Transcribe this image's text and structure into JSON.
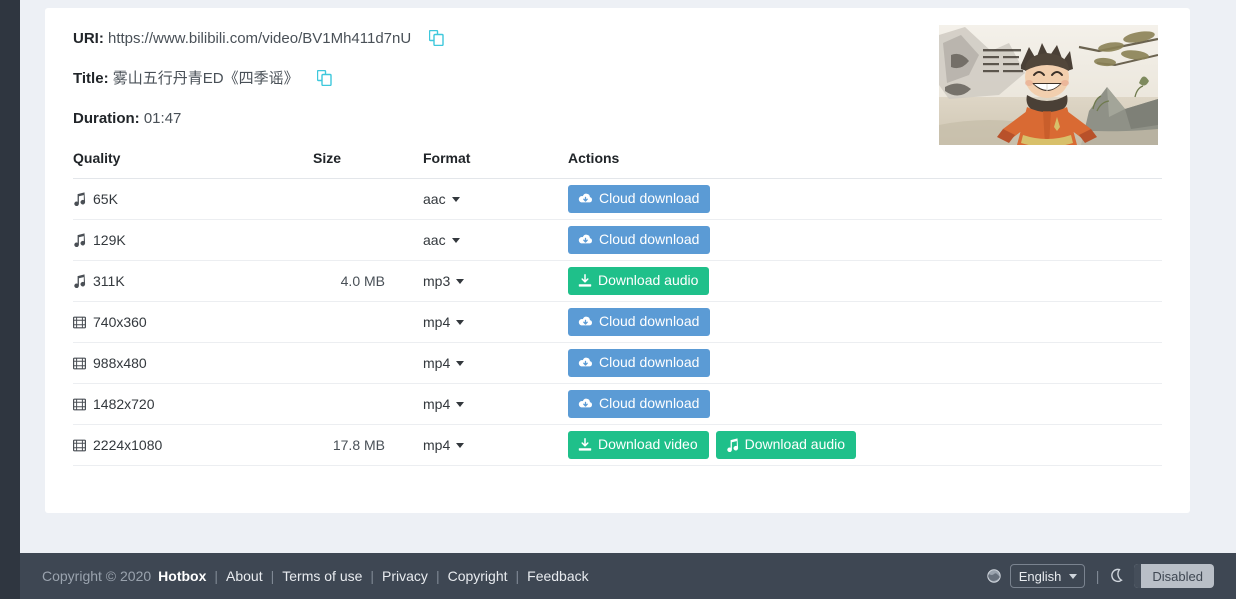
{
  "meta": {
    "uri_label": "URI:",
    "uri_value": "https://www.bilibili.com/video/BV1Mh411d7nU",
    "title_label": "Title:",
    "title_value": "雾山五行丹青ED《四季谣》",
    "duration_label": "Duration:",
    "duration_value": "01:47"
  },
  "icons": {
    "copy": "copy-icon",
    "audio": "music-note-icon",
    "video": "film-icon",
    "cloud": "cloud-download-icon",
    "download": "download-tray-icon",
    "globe": "globe-icon",
    "moon": "moon-icon"
  },
  "table": {
    "headers": [
      "Quality",
      "Size",
      "Format",
      "Actions"
    ],
    "rows": [
      {
        "kind": "audio",
        "quality": "65K",
        "size": "",
        "format": "aac",
        "actions": [
          {
            "label": "Cloud download",
            "style": "blue",
            "icon": "cloud-download-icon"
          }
        ]
      },
      {
        "kind": "audio",
        "quality": "129K",
        "size": "",
        "format": "aac",
        "actions": [
          {
            "label": "Cloud download",
            "style": "blue",
            "icon": "cloud-download-icon"
          }
        ]
      },
      {
        "kind": "audio",
        "quality": "311K",
        "size": "4.0 MB",
        "format": "mp3",
        "actions": [
          {
            "label": "Download audio",
            "style": "green",
            "icon": "download-tray-icon"
          }
        ]
      },
      {
        "kind": "video",
        "quality": "740x360",
        "size": "",
        "format": "mp4",
        "actions": [
          {
            "label": "Cloud download",
            "style": "blue",
            "icon": "cloud-download-icon"
          }
        ]
      },
      {
        "kind": "video",
        "quality": "988x480",
        "size": "",
        "format": "mp4",
        "actions": [
          {
            "label": "Cloud download",
            "style": "blue",
            "icon": "cloud-download-icon"
          }
        ]
      },
      {
        "kind": "video",
        "quality": "1482x720",
        "size": "",
        "format": "mp4",
        "actions": [
          {
            "label": "Cloud download",
            "style": "blue",
            "icon": "cloud-download-icon"
          }
        ]
      },
      {
        "kind": "video",
        "quality": "2224x1080",
        "size": "17.8 MB",
        "format": "mp4",
        "actions": [
          {
            "label": "Download video",
            "style": "green",
            "icon": "download-tray-icon"
          },
          {
            "label": "Download audio",
            "style": "green",
            "icon": "music-note-icon"
          }
        ]
      }
    ]
  },
  "footer": {
    "copyright": "Copyright © 2020",
    "brand": "Hotbox",
    "links": [
      "About",
      "Terms of use",
      "Privacy",
      "Copyright",
      "Feedback"
    ],
    "language": "English",
    "language_options": [
      "English"
    ],
    "dark_mode_state": "Disabled"
  },
  "colors": {
    "blue_button": "#5b9bd5",
    "green_button": "#1fc08a",
    "copy_icon": "#3ec8dc",
    "footer_bg": "#3e4753",
    "page_bg": "#edf0f5"
  }
}
